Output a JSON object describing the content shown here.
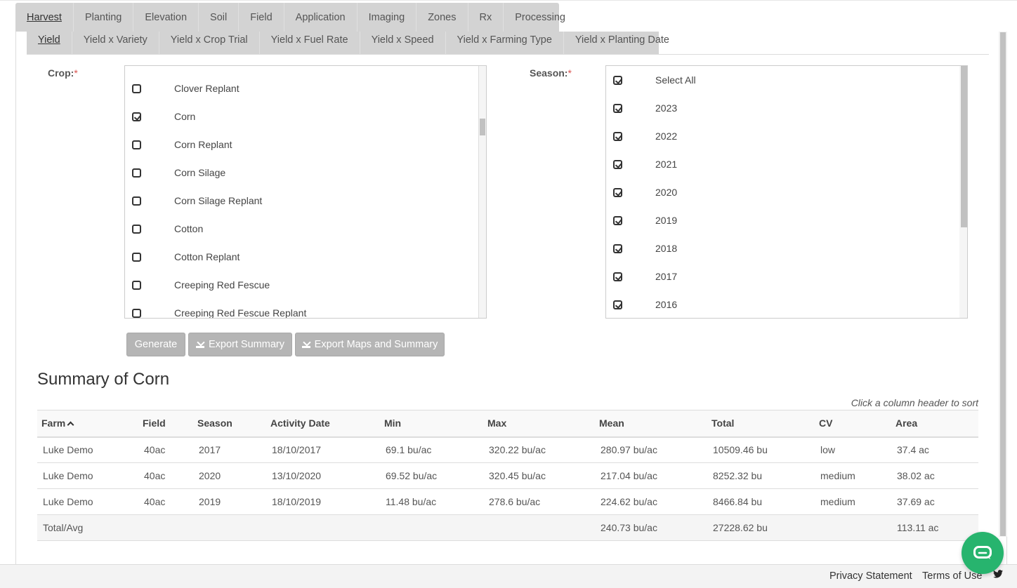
{
  "main_tabs": [
    "Harvest",
    "Planting",
    "Elevation",
    "Soil",
    "Field",
    "Application",
    "Imaging",
    "Zones",
    "Rx",
    "Processing"
  ],
  "main_tab_active": "Harvest",
  "sub_tabs": [
    "Yield",
    "Yield x Variety",
    "Yield x Crop Trial",
    "Yield x Fuel Rate",
    "Yield x Speed",
    "Yield x Farming Type",
    "Yield x Planting Date"
  ],
  "sub_tab_active": "Yield",
  "crop": {
    "label": "Crop:",
    "required_mark": "*",
    "items": [
      {
        "label": "Clover Replant",
        "checked": false
      },
      {
        "label": "Corn",
        "checked": true
      },
      {
        "label": "Corn Replant",
        "checked": false
      },
      {
        "label": "Corn Silage",
        "checked": false
      },
      {
        "label": "Corn Silage Replant",
        "checked": false
      },
      {
        "label": "Cotton",
        "checked": false
      },
      {
        "label": "Cotton Replant",
        "checked": false
      },
      {
        "label": "Creeping Red Fescue",
        "checked": false
      },
      {
        "label": "Creeping Red Fescue Replant",
        "checked": false
      }
    ]
  },
  "season": {
    "label": "Season:",
    "required_mark": "*",
    "items": [
      {
        "label": "Select All",
        "checked": true
      },
      {
        "label": "2023",
        "checked": true
      },
      {
        "label": "2022",
        "checked": true
      },
      {
        "label": "2021",
        "checked": true
      },
      {
        "label": "2020",
        "checked": true
      },
      {
        "label": "2019",
        "checked": true
      },
      {
        "label": "2018",
        "checked": true
      },
      {
        "label": "2017",
        "checked": true
      },
      {
        "label": "2016",
        "checked": true
      }
    ]
  },
  "buttons": {
    "generate": "Generate",
    "export_summary": "Export Summary",
    "export_maps": "Export Maps and Summary"
  },
  "summary": {
    "title": "Summary of Corn",
    "sort_hint": "Click a column header to sort",
    "columns": [
      "Farm",
      "Field",
      "Season",
      "Activity Date",
      "Min",
      "Max",
      "Mean",
      "Total",
      "CV",
      "Area"
    ],
    "sorted_column": "Farm",
    "rows": [
      [
        "Luke Demo",
        "40ac",
        "2017",
        "18/10/2017",
        "69.1 bu/ac",
        "320.22 bu/ac",
        "280.97 bu/ac",
        "10509.46 bu",
        "low",
        "37.4 ac"
      ],
      [
        "Luke Demo",
        "40ac",
        "2020",
        "13/10/2020",
        "69.52 bu/ac",
        "320.45 bu/ac",
        "217.04 bu/ac",
        "8252.32 bu",
        "medium",
        "38.02 ac"
      ],
      [
        "Luke Demo",
        "40ac",
        "2019",
        "18/10/2019",
        "11.48 bu/ac",
        "278.6 bu/ac",
        "224.62 bu/ac",
        "8466.84 bu",
        "medium",
        "37.69 ac"
      ]
    ],
    "total_row": [
      "Total/Avg",
      "",
      "",
      "",
      "",
      "",
      "240.73 bu/ac",
      "27228.62 bu",
      "",
      "113.11 ac"
    ]
  },
  "footer": {
    "privacy": "Privacy Statement",
    "terms": "Terms of Use"
  },
  "colors": {
    "tab_bg": "#d3d3d3",
    "button_bg": "#b5b5b5",
    "required": "#d9534f",
    "chat_green": "#27b46e"
  },
  "icons": [
    "checkbox-icon",
    "download-icon",
    "sort-up-icon",
    "twitter-icon",
    "chat-icon"
  ]
}
